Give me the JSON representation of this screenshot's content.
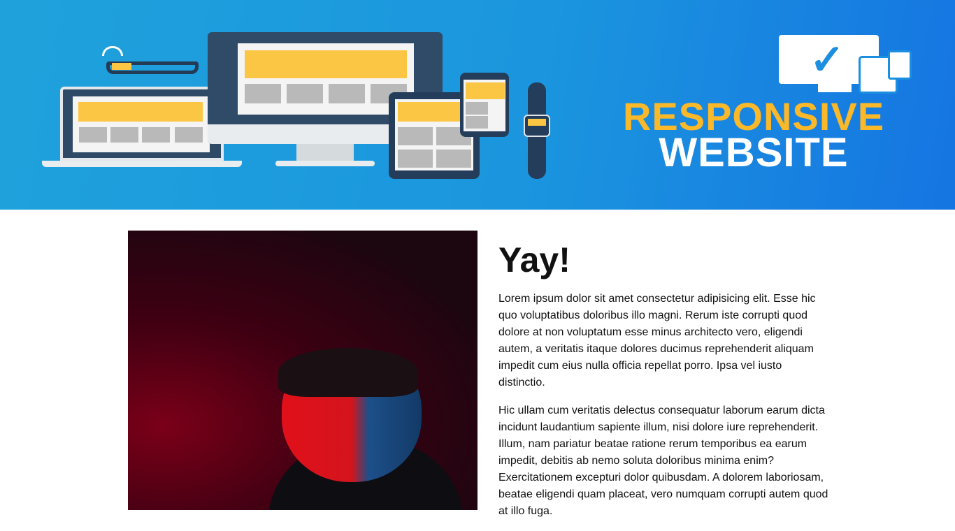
{
  "banner": {
    "logo_line1": "RESPONSIVE",
    "logo_line2": "WEBSITE",
    "colors": {
      "accent": "#fbb829",
      "background": "#1b96de"
    }
  },
  "article": {
    "heading": "Yay!",
    "paragraphs": [
      "Lorem ipsum dolor sit amet consectetur adipisicing elit. Esse hic quo voluptatibus doloribus illo magni. Rerum iste corrupti quod dolore at non voluptatum esse minus architecto vero, eligendi autem, a veritatis itaque dolores ducimus reprehenderit aliquam impedit cum eius nulla officia repellat porro. Ipsa vel iusto distinctio.",
      "Hic ullam cum veritatis delectus consequatur laborum earum dicta incidunt laudantium sapiente illum, nisi dolore iure reprehenderit. Illum, nam pariatur beatae ratione rerum temporibus ea earum impedit, debitis ab nemo soluta doloribus minima enim? Exercitationem excepturi dolor quibusdam. A dolorem laboriosam, beatae eligendi quam placeat, vero numquam corrupti autem quod at illo fuga."
    ]
  }
}
